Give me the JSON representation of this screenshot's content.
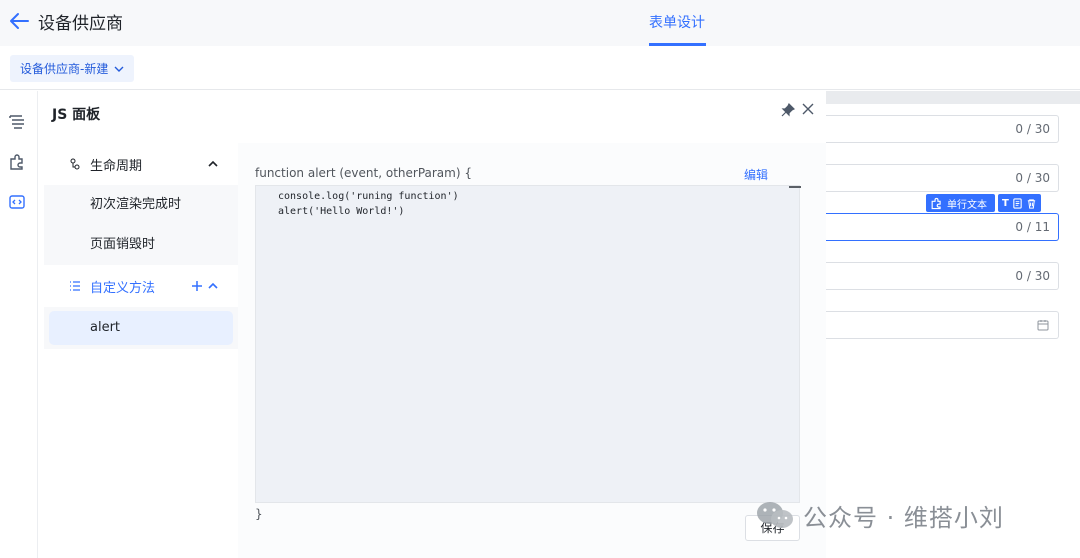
{
  "header": {
    "title": "设备供应商",
    "active_tab": "表单设计"
  },
  "breadcrumb": {
    "label": "设备供应商-新建"
  },
  "js_panel": {
    "title": "JS 面板",
    "lifecycle": {
      "label": "生命周期",
      "items": [
        "初次渲染完成时",
        "页面销毁时"
      ]
    },
    "custom_methods": {
      "label": "自定义方法",
      "items": [
        "alert"
      ]
    },
    "editor": {
      "signature": "function alert (event, otherParam) {",
      "edit_label": "编辑",
      "lines": [
        "console.log('runing function')",
        "alert('Hello World!')"
      ],
      "closing": "}",
      "save_label": "保存"
    }
  },
  "form_fields": [
    {
      "counter": "0 / 30"
    },
    {
      "counter": "0 / 30"
    },
    {
      "counter": "0 / 11",
      "active": true
    },
    {
      "counter": "0 / 30"
    },
    {
      "counter": ""
    }
  ],
  "widget_toolbar": {
    "label": "单行文本",
    "type_glyph": "T"
  },
  "watermark": {
    "text": "公众号 · 维搭小刘"
  },
  "colors": {
    "accent": "#3370ff",
    "panel_bg": "#f7f8fa"
  }
}
